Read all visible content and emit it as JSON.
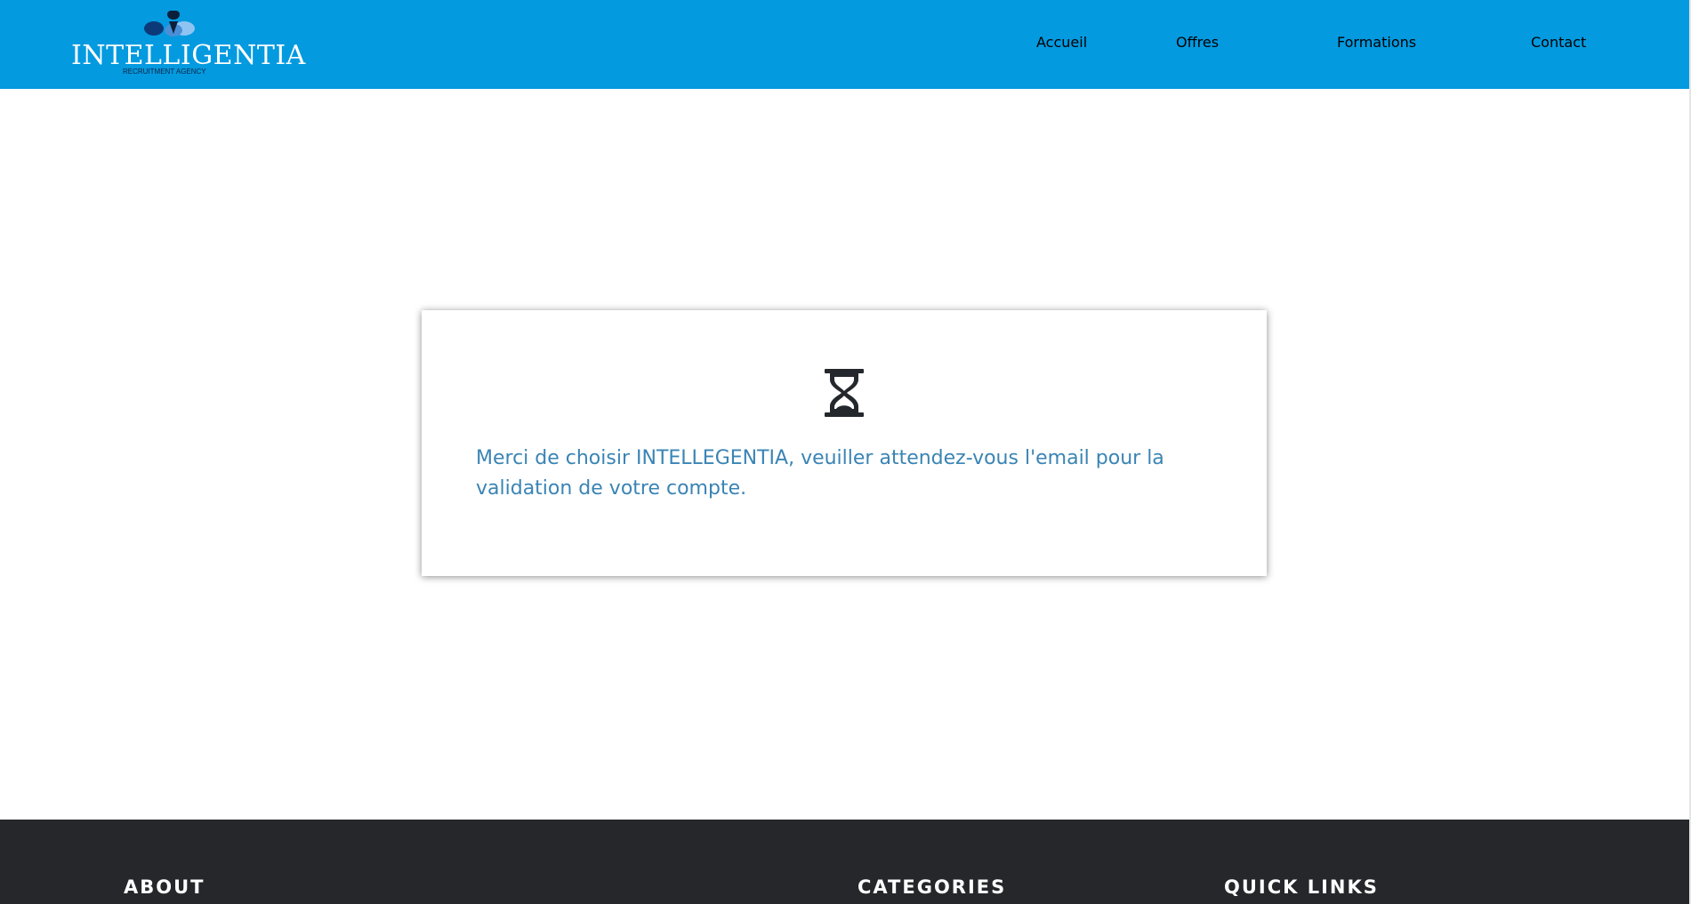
{
  "brand": {
    "name": "INTELLIGENTIA",
    "tagline": "RECRUITMENT AGENCY",
    "colors": {
      "navbar": "#039ae0",
      "drop_dark": "#0c3a78",
      "drop_light": "#8fc4f2"
    }
  },
  "nav": {
    "items": [
      {
        "label": "Accueil",
        "dropdown": false
      },
      {
        "label": "Offres",
        "dropdown": true
      },
      {
        "label": "Formations",
        "dropdown": true
      },
      {
        "label": "Contact",
        "dropdown": false
      }
    ]
  },
  "card": {
    "icon": "hourglass-icon",
    "message": "Merci de choisir INTELLEGENTIA, veuiller attendez-vous l'email pour la validation de votre compte.",
    "message_color": "#3a84b4"
  },
  "footer": {
    "background": "#25272b",
    "columns": [
      {
        "title": "ABOUT"
      },
      {
        "title": "CATEGORIES"
      },
      {
        "title": "QUICK LINKS"
      }
    ]
  }
}
